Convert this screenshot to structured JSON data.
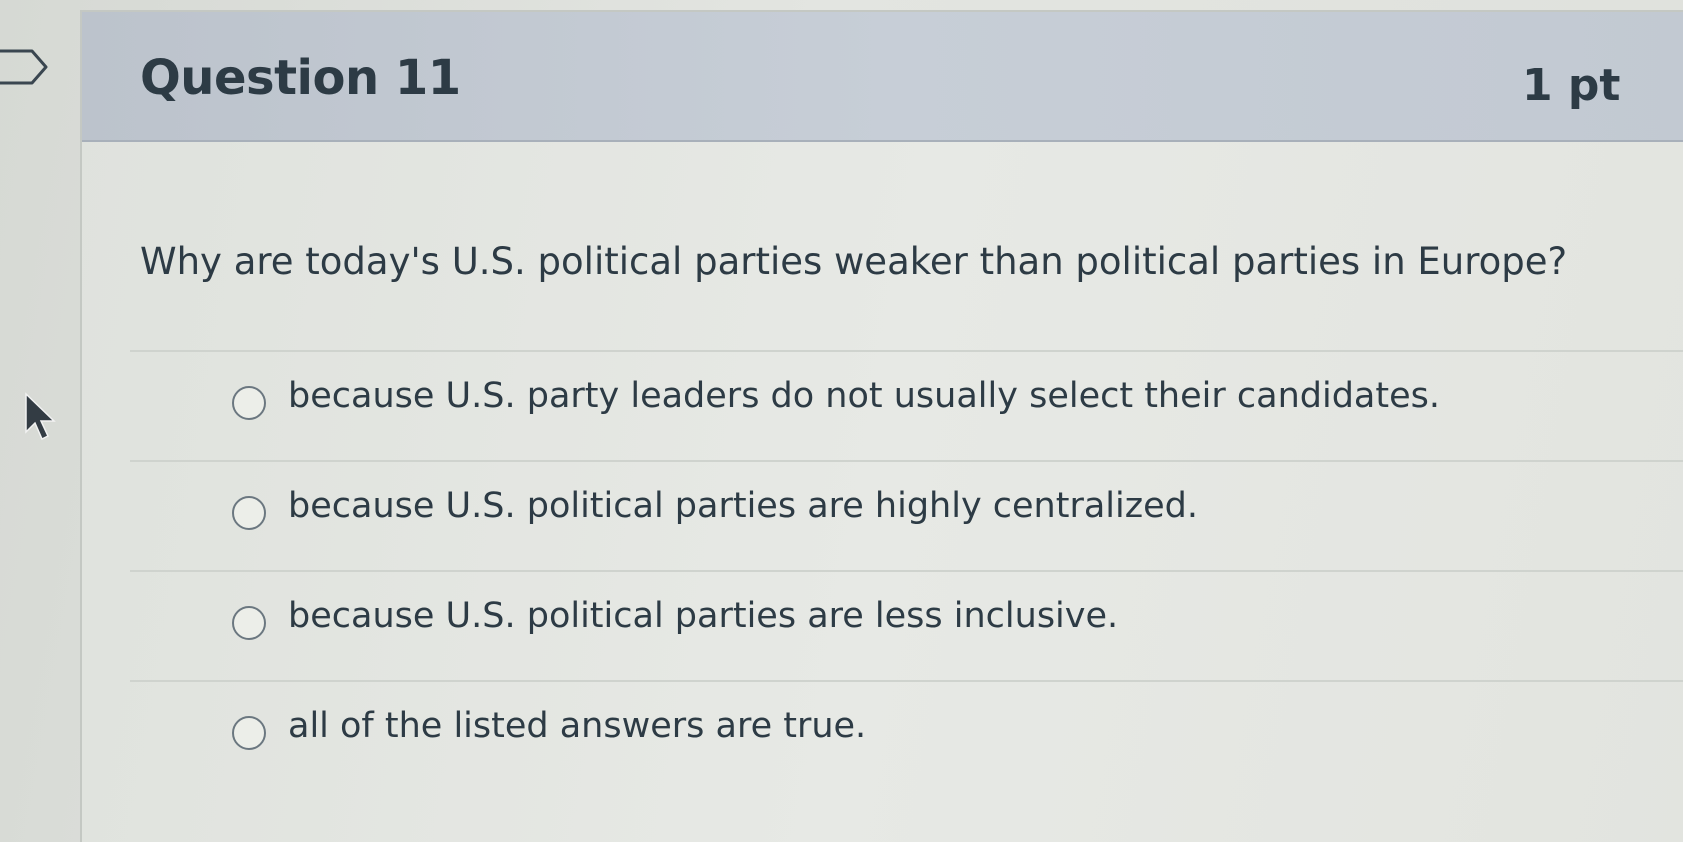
{
  "question": {
    "title": "Question 11",
    "points": "1 pt",
    "text": "Why are today's U.S. political parties weaker than political parties in Europe?"
  },
  "answers": [
    {
      "label": "because U.S. party leaders do not usually select their candidates."
    },
    {
      "label": "because U.S. political parties are highly centralized."
    },
    {
      "label": "because U.S. political parties are less inclusive."
    },
    {
      "label": "all of the listed answers are true."
    }
  ],
  "icons": {
    "flag": "flag-icon",
    "cursor": "mouse-pointer-icon"
  }
}
